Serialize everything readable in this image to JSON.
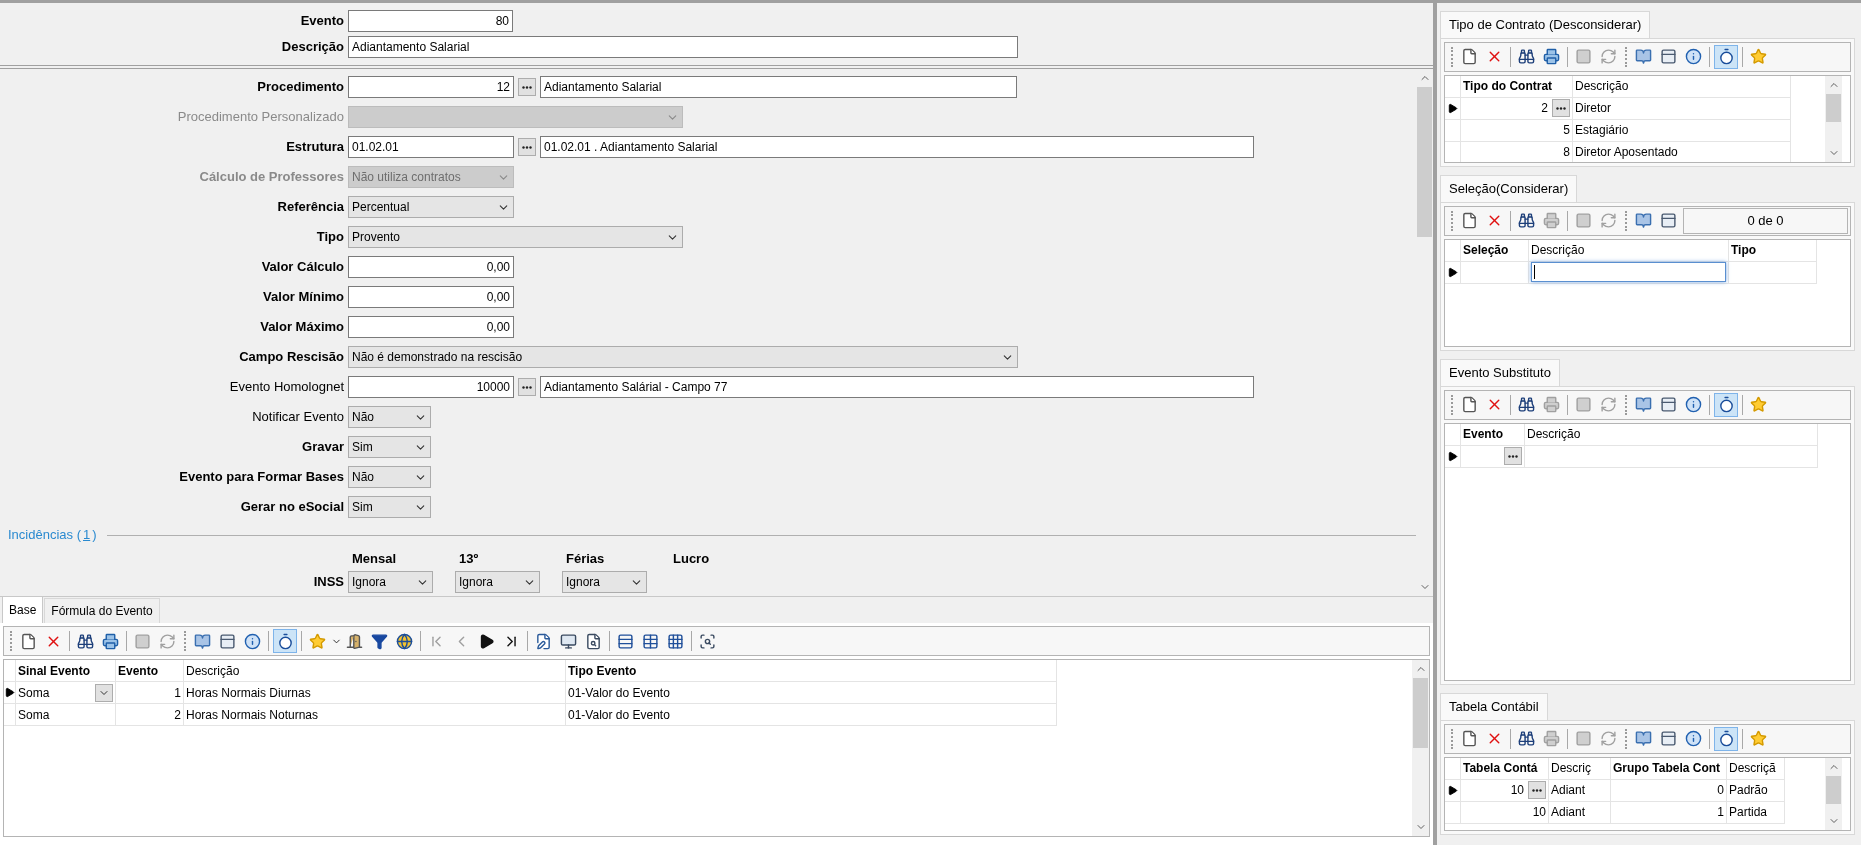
{
  "header": {
    "fields": [
      {
        "label": "Evento",
        "kind": "number",
        "value": "80",
        "required": true
      },
      {
        "label": "Descrição",
        "kind": "text",
        "value": "Adiantamento Salarial",
        "required": true
      }
    ]
  },
  "form": {
    "fields": [
      {
        "label": "Procedimento",
        "kind": "lookup",
        "code": "12",
        "description": "Adiantamento Salarial",
        "required": true,
        "disabled": false
      },
      {
        "label": "Procedimento Personalizado",
        "kind": "select",
        "required": false,
        "disabled": true
      },
      {
        "label": "Estrutura",
        "kind": "code_lookup",
        "code": "01.02.01",
        "description": "01.02.01  .  Adiantamento Salarial",
        "required": true,
        "disabled": false
      },
      {
        "label": "Cálculo de Professores",
        "kind": "select",
        "value": "Não utiliza contratos",
        "required": true,
        "disabled": true
      },
      {
        "label": "Referência",
        "kind": "select",
        "value": "Percentual",
        "required": true,
        "disabled": false
      },
      {
        "label": "Tipo",
        "kind": "select",
        "value": "Provento",
        "required": true,
        "disabled": false
      },
      {
        "label": "Valor Cálculo",
        "kind": "number",
        "value": "0,00",
        "required": true,
        "disabled": false
      },
      {
        "label": "Valor Mínimo",
        "kind": "number",
        "value": "0,00",
        "required": true,
        "disabled": false
      },
      {
        "label": "Valor Máximo",
        "kind": "number",
        "value": "0,00",
        "required": true,
        "disabled": false
      },
      {
        "label": "Campo Rescisão",
        "kind": "select",
        "value": "Não é demonstrado na rescisão",
        "required": true,
        "disabled": false
      },
      {
        "label": "Evento Homolognet",
        "kind": "lookup",
        "code": "10000",
        "description": "Adiantamento Salárial - Campo 77",
        "required": false,
        "disabled": false
      },
      {
        "label": "Notificar Evento",
        "kind": "select",
        "value": "Não",
        "required": false,
        "disabled": false
      },
      {
        "label": "Gravar",
        "kind": "select",
        "value": "Sim",
        "required": true,
        "disabled": false
      },
      {
        "label": "Evento para Formar Bases",
        "kind": "select",
        "value": "Não",
        "required": true,
        "disabled": false
      },
      {
        "label": "Gerar no eSocial",
        "kind": "select",
        "value": "Sim",
        "required": true,
        "disabled": false
      }
    ],
    "incidences": {
      "title": "Incidências (",
      "link": "1",
      "title_end": ")",
      "columns": [
        "Mensal",
        "13º",
        "Férias",
        "Lucro"
      ],
      "rows": [
        {
          "label": "INSS",
          "values": [
            "Ignora",
            "Ignora",
            "Ignora"
          ]
        }
      ]
    }
  },
  "bottom": {
    "tabs": [
      {
        "label": "Base",
        "selected": true
      },
      {
        "label": "Fórmula do Evento",
        "selected": false
      }
    ],
    "toolbar": [
      {
        "kind": "grip"
      },
      {
        "kind": "new",
        "disabled": false,
        "pressed": false
      },
      {
        "kind": "delete",
        "disabled": false,
        "pressed": false
      },
      {
        "kind": "sep"
      },
      {
        "kind": "find",
        "disabled": false,
        "pressed": false
      },
      {
        "kind": "print",
        "disabled": false,
        "pressed": false
      },
      {
        "kind": "sep"
      },
      {
        "kind": "save",
        "disabled": true,
        "pressed": false
      },
      {
        "kind": "refresh",
        "disabled": true,
        "pressed": false
      },
      {
        "kind": "grip"
      },
      {
        "kind": "help",
        "disabled": false,
        "pressed": false
      },
      {
        "kind": "layout",
        "disabled": false,
        "pressed": false
      },
      {
        "kind": "info",
        "disabled": false,
        "pressed": false
      },
      {
        "kind": "sep"
      },
      {
        "kind": "timer",
        "disabled": false,
        "pressed": true
      },
      {
        "kind": "sep"
      },
      {
        "kind": "star",
        "disabled": false,
        "pressed": false
      },
      {
        "kind": "menu",
        "disabled": false,
        "pressed": false
      },
      {
        "kind": "exit",
        "disabled": false,
        "pressed": false
      },
      {
        "kind": "filter",
        "disabled": false,
        "pressed": false
      },
      {
        "kind": "export",
        "disabled": false,
        "pressed": false
      },
      {
        "kind": "sep"
      },
      {
        "kind": "first",
        "disabled": true,
        "pressed": false
      },
      {
        "kind": "prev",
        "disabled": true,
        "pressed": false
      },
      {
        "kind": "next",
        "disabled": false,
        "pressed": false
      },
      {
        "kind": "last",
        "disabled": false,
        "pressed": false
      },
      {
        "kind": "sep"
      },
      {
        "kind": "edit",
        "disabled": false,
        "pressed": false
      },
      {
        "kind": "report",
        "disabled": false,
        "pressed": false
      },
      {
        "kind": "search_doc",
        "disabled": false,
        "pressed": false
      },
      {
        "kind": "sep"
      },
      {
        "kind": "rows",
        "disabled": false,
        "pressed": false
      },
      {
        "kind": "table",
        "disabled": false,
        "pressed": false
      },
      {
        "kind": "grid",
        "disabled": false,
        "pressed": false
      },
      {
        "kind": "sep"
      },
      {
        "kind": "preview",
        "disabled": false,
        "pressed": false
      }
    ],
    "grid": {
      "columns": [
        {
          "label": "Sinal Evento",
          "required": true
        },
        {
          "label": "Evento",
          "required": true
        },
        {
          "label": "Descrição",
          "required": false
        },
        {
          "label": "Tipo Evento",
          "required": true
        }
      ],
      "rows": [
        {
          "current": true,
          "cells": [
            {
              "kind": "select",
              "text": "Soma"
            },
            {
              "kind": "text",
              "text": "1"
            },
            {
              "kind": "text",
              "text": "Horas Normais Diurnas"
            },
            {
              "kind": "text",
              "text": "01-Valor do Evento"
            }
          ]
        },
        {
          "current": false,
          "cells": [
            {
              "kind": "text",
              "text": "Soma"
            },
            {
              "kind": "text",
              "text": "2"
            },
            {
              "kind": "text",
              "text": "Horas Normais Noturnas"
            },
            {
              "kind": "text",
              "text": "01-Valor do Evento"
            }
          ]
        }
      ]
    }
  },
  "panels": [
    {
      "title": "Tipo de Contrato (Desconsiderar)",
      "toolbar": [
        {
          "kind": "grip"
        },
        {
          "kind": "new",
          "disabled": false,
          "pressed": false
        },
        {
          "kind": "delete",
          "disabled": false,
          "pressed": false
        },
        {
          "kind": "sep"
        },
        {
          "kind": "find",
          "disabled": false,
          "pressed": false
        },
        {
          "kind": "print",
          "disabled": false,
          "pressed": false
        },
        {
          "kind": "sep"
        },
        {
          "kind": "save",
          "disabled": true,
          "pressed": false
        },
        {
          "kind": "refresh",
          "disabled": true,
          "pressed": false
        },
        {
          "kind": "grip"
        },
        {
          "kind": "help",
          "disabled": false,
          "pressed": false
        },
        {
          "kind": "layout",
          "disabled": false,
          "pressed": false
        },
        {
          "kind": "info",
          "disabled": false,
          "pressed": false
        },
        {
          "kind": "sep"
        },
        {
          "kind": "timer",
          "disabled": false,
          "pressed": true
        },
        {
          "kind": "sep"
        },
        {
          "kind": "star",
          "disabled": false,
          "pressed": false
        }
      ],
      "columns": [
        {
          "label": "Tipo do Contrat",
          "required": true
        },
        {
          "label": "Descrição",
          "required": false
        }
      ],
      "rows": [
        {
          "current": true,
          "cells": [
            {
              "kind": "lookup",
              "text": "2"
            },
            {
              "kind": "text",
              "text": "Diretor"
            }
          ]
        },
        {
          "current": false,
          "cells": [
            {
              "kind": "text",
              "text": "5"
            },
            {
              "kind": "text",
              "text": "Estagiário"
            }
          ]
        },
        {
          "current": false,
          "cells": [
            {
              "kind": "text",
              "text": "8"
            },
            {
              "kind": "text",
              "text": "Diretor Aposentado"
            }
          ]
        }
      ]
    },
    {
      "title": "Seleção(Considerar)",
      "counter": "0 de 0",
      "toolbar": [
        {
          "kind": "grip"
        },
        {
          "kind": "new",
          "disabled": false,
          "pressed": false
        },
        {
          "kind": "delete",
          "disabled": false,
          "pressed": false
        },
        {
          "kind": "sep"
        },
        {
          "kind": "find",
          "disabled": false,
          "pressed": false
        },
        {
          "kind": "print",
          "disabled": true,
          "pressed": false
        },
        {
          "kind": "sep"
        },
        {
          "kind": "save",
          "disabled": true,
          "pressed": false
        },
        {
          "kind": "refresh",
          "disabled": true,
          "pressed": false
        },
        {
          "kind": "grip"
        },
        {
          "kind": "help",
          "disabled": false,
          "pressed": false
        },
        {
          "kind": "layout",
          "disabled": false,
          "pressed": false
        }
      ],
      "columns": [
        {
          "label": "Seleção",
          "required": true
        },
        {
          "label": "Descrição",
          "required": false
        },
        {
          "label": "Tipo",
          "required": true
        }
      ],
      "rows": [
        {
          "current": true,
          "cells": [
            {
              "kind": "empty"
            },
            {
              "kind": "editing"
            },
            {
              "kind": "empty"
            }
          ]
        }
      ]
    },
    {
      "title": "Evento Substituto",
      "toolbar": [
        {
          "kind": "grip"
        },
        {
          "kind": "new",
          "disabled": false,
          "pressed": false
        },
        {
          "kind": "delete",
          "disabled": false,
          "pressed": false
        },
        {
          "kind": "sep"
        },
        {
          "kind": "find",
          "disabled": false,
          "pressed": false
        },
        {
          "kind": "print",
          "disabled": true,
          "pressed": false
        },
        {
          "kind": "sep"
        },
        {
          "kind": "save",
          "disabled": true,
          "pressed": false
        },
        {
          "kind": "refresh",
          "disabled": true,
          "pressed": false
        },
        {
          "kind": "grip"
        },
        {
          "kind": "help",
          "disabled": false,
          "pressed": false
        },
        {
          "kind": "layout",
          "disabled": false,
          "pressed": false
        },
        {
          "kind": "info",
          "disabled": false,
          "pressed": false
        },
        {
          "kind": "sep"
        },
        {
          "kind": "timer",
          "disabled": false,
          "pressed": true
        },
        {
          "kind": "sep"
        },
        {
          "kind": "star",
          "disabled": false,
          "pressed": false
        }
      ],
      "columns": [
        {
          "label": "Evento",
          "required": true
        },
        {
          "label": "Descrição",
          "required": false
        }
      ],
      "rows": [
        {
          "current": true,
          "cells": [
            {
              "kind": "lookup"
            },
            {
              "kind": "empty"
            }
          ]
        }
      ]
    },
    {
      "title": "Tabela Contábil",
      "toolbar": [
        {
          "kind": "grip"
        },
        {
          "kind": "new",
          "disabled": false,
          "pressed": false
        },
        {
          "kind": "delete",
          "disabled": false,
          "pressed": false
        },
        {
          "kind": "sep"
        },
        {
          "kind": "find",
          "disabled": false,
          "pressed": false
        },
        {
          "kind": "print",
          "disabled": true,
          "pressed": false
        },
        {
          "kind": "sep"
        },
        {
          "kind": "save",
          "disabled": true,
          "pressed": false
        },
        {
          "kind": "refresh",
          "disabled": true,
          "pressed": false
        },
        {
          "kind": "grip"
        },
        {
          "kind": "help",
          "disabled": false,
          "pressed": false
        },
        {
          "kind": "layout",
          "disabled": false,
          "pressed": false
        },
        {
          "kind": "info",
          "disabled": false,
          "pressed": false
        },
        {
          "kind": "sep"
        },
        {
          "kind": "timer",
          "disabled": false,
          "pressed": true
        },
        {
          "kind": "sep"
        },
        {
          "kind": "star",
          "disabled": false,
          "pressed": false
        }
      ],
      "columns": [
        {
          "label": "Tabela Contá",
          "required": true
        },
        {
          "label": "Descriç",
          "required": false
        },
        {
          "label": "Grupo Tabela Cont",
          "required": true
        },
        {
          "label": "Descriçã",
          "required": false
        }
      ],
      "rows": [
        {
          "current": true,
          "cells": [
            {
              "kind": "lookup",
              "text": "10"
            },
            {
              "kind": "text",
              "text": "Adiant"
            },
            {
              "kind": "text",
              "text": "0"
            },
            {
              "kind": "text",
              "text": "Padrão"
            }
          ]
        },
        {
          "current": false,
          "cells": [
            {
              "kind": "text",
              "text": "10"
            },
            {
              "kind": "text",
              "text": "Adiant"
            },
            {
              "kind": "text",
              "text": "1"
            },
            {
              "kind": "text",
              "text": "Partida"
            }
          ]
        }
      ]
    }
  ]
}
